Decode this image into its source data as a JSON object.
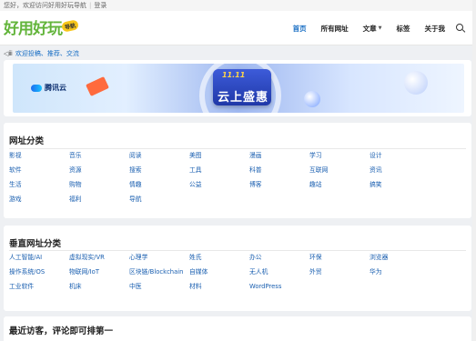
{
  "topbar": {
    "welcome": "您好，欢迎访问好用好玩导航",
    "separator": "|",
    "login": "登录"
  },
  "header": {
    "logo_text": "好用好玩",
    "logo_badge": "导航"
  },
  "nav": [
    {
      "label": "首页",
      "active": true
    },
    {
      "label": "所有网址"
    },
    {
      "label": "文章",
      "dropdown": true
    },
    {
      "label": "标签"
    },
    {
      "label": "关于我"
    }
  ],
  "notice": {
    "text": "欢迎投稿、推荐、交流"
  },
  "banner": {
    "brand": "腾讯云",
    "promo_top": "11.11",
    "promo_main": "云上盛惠"
  },
  "sections": [
    {
      "title": "网址分类",
      "items": [
        "影视",
        "音乐",
        "阅读",
        "美图",
        "漫画",
        "学习",
        "设计",
        "软件",
        "资源",
        "搜索",
        "工具",
        "科普",
        "互联网",
        "资讯",
        "生活",
        "购物",
        "情趣",
        "公益",
        "博客",
        "趣站",
        "搞笑",
        "游戏",
        "福利",
        "导航"
      ]
    },
    {
      "title": "垂直网址分类",
      "items": [
        "人工智能/AI",
        "虚拟现实/VR",
        "心理学",
        "姓氏",
        "办公",
        "环保",
        "浏览器",
        "操作系统/OS",
        "物联网/IoT",
        "区块链/Blockchain",
        "自媒体",
        "无人机",
        "外贸",
        "华为",
        "工业软件",
        "机床",
        "中医",
        "材料",
        "WordPress"
      ]
    },
    {
      "title": "最近访客，评论即可排第一"
    }
  ],
  "colors": {
    "accent": "#1a6fc4",
    "link": "#1a5fb0",
    "logo_green": "#62b43a"
  }
}
